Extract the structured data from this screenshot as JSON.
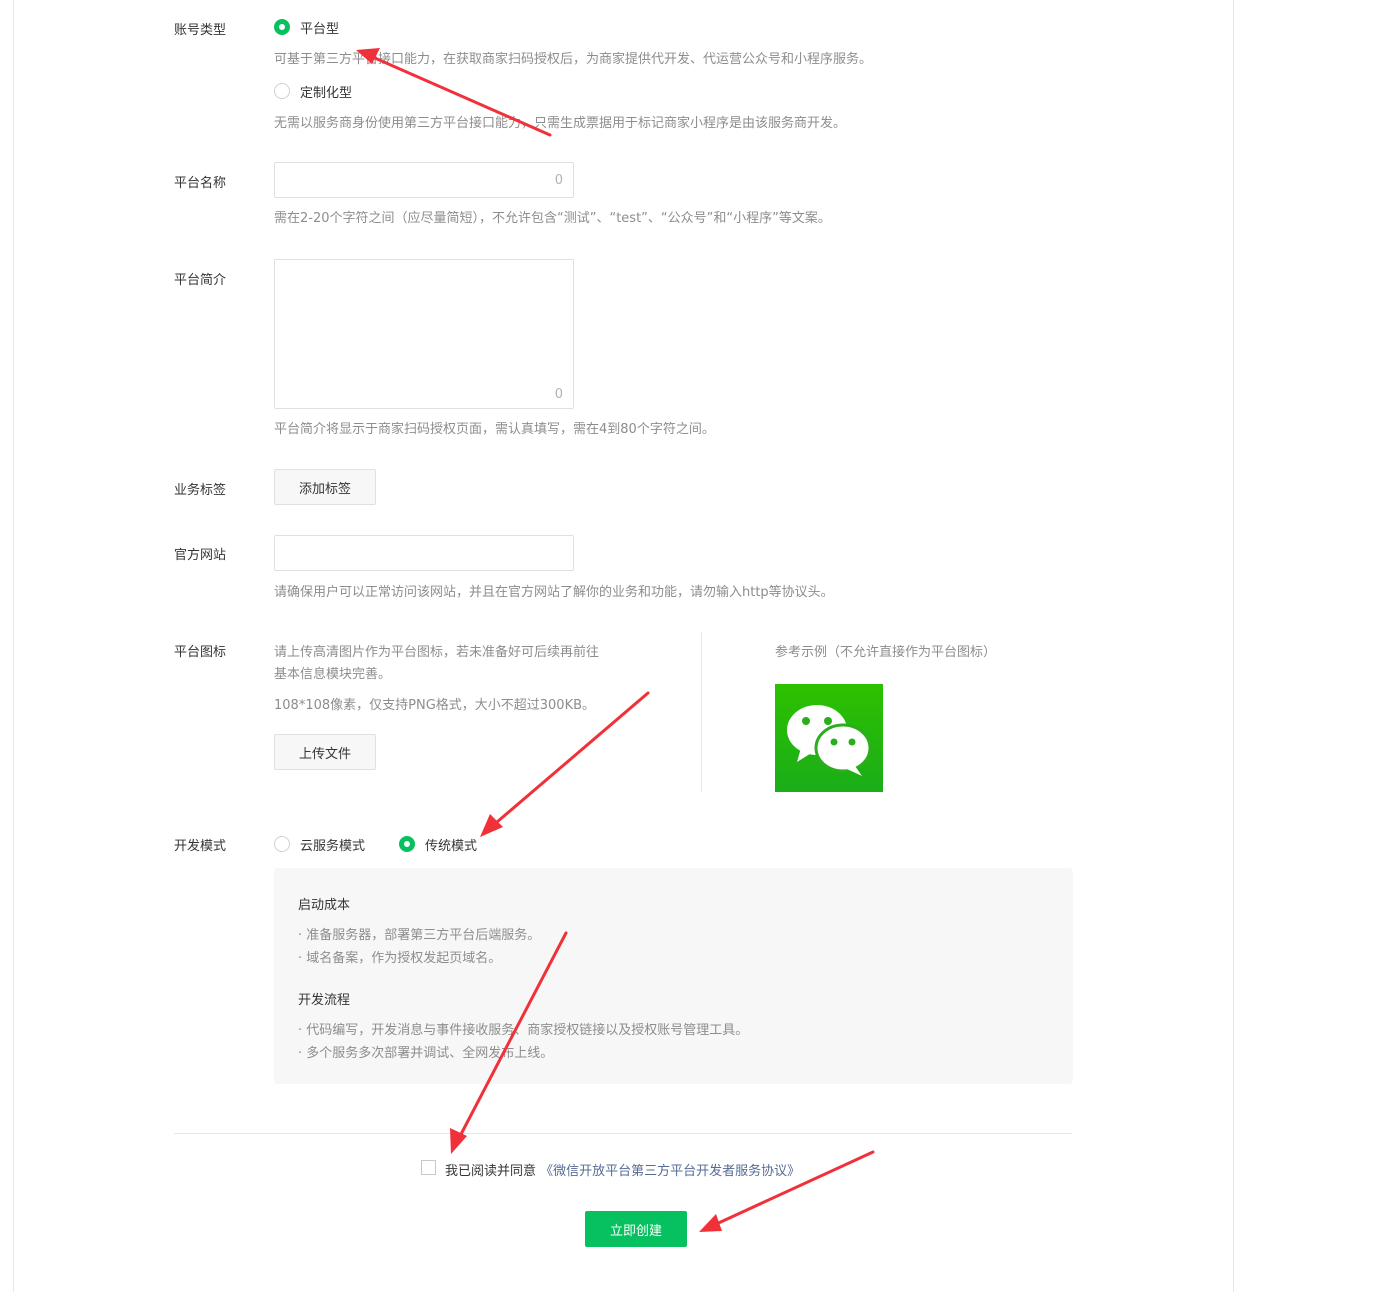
{
  "account_type": {
    "label": "账号类型",
    "option_platform": "平台型",
    "option_platform_tip": "可基于第三方平台接口能力，在获取商家扫码授权后，为商家提供代开发、代运营公众号和小程序服务。",
    "option_custom": "定制化型",
    "option_custom_tip": "无需以服务商身份使用第三方平台接口能力，只需生成票据用于标记商家小程序是由该服务商开发。"
  },
  "platform_name": {
    "label": "平台名称",
    "counter": "0",
    "tip": "需在2-20个字符之间（应尽量简短），不允许包含“测试”、“test”、“公众号”和“小程序”等文案。"
  },
  "platform_intro": {
    "label": "平台简介",
    "counter": "0",
    "tip": "平台简介将显示于商家扫码授权页面，需认真填写，需在4到80个字符之间。"
  },
  "business_tags": {
    "label": "业务标签",
    "button": "添加标签"
  },
  "website": {
    "label": "官方网站",
    "tip": "请确保用户可以正常访问该网站，并且在官方网站了解你的业务和功能，请勿输入http等协议头。"
  },
  "platform_icon": {
    "label": "平台图标",
    "tip_line1": "请上传高清图片作为平台图标，若未准备好可后续再前往",
    "tip_line2": "基本信息模块完善。",
    "spec": "108*108像素，仅支持PNG格式，大小不超过300KB。",
    "upload_button": "上传文件",
    "example_title": "参考示例（不允许直接作为平台图标）",
    "example_icon": "wechat-logo"
  },
  "dev_mode": {
    "label": "开发模式",
    "option_cloud": "云服务模式",
    "option_traditional": "传统模式",
    "section1_title": "启动成本",
    "section1_items": [
      "· 准备服务器，部署第三方平台后端服务。",
      "· 域名备案，作为授权发起页域名。"
    ],
    "section2_title": "开发流程",
    "section2_items": [
      "· 代码编写，开发消息与事件接收服务、商家授权链接以及授权账号管理工具。",
      "· 多个服务多次部署并调试、全网发布上线。"
    ]
  },
  "agreement": {
    "prefix": "我已阅读并同意",
    "link": "《微信开放平台第三方平台开发者服务协议》"
  },
  "submit_button": "立即创建",
  "colors": {
    "primary": "#07c160",
    "arrow": "#f0313a",
    "link": "#576b95"
  }
}
